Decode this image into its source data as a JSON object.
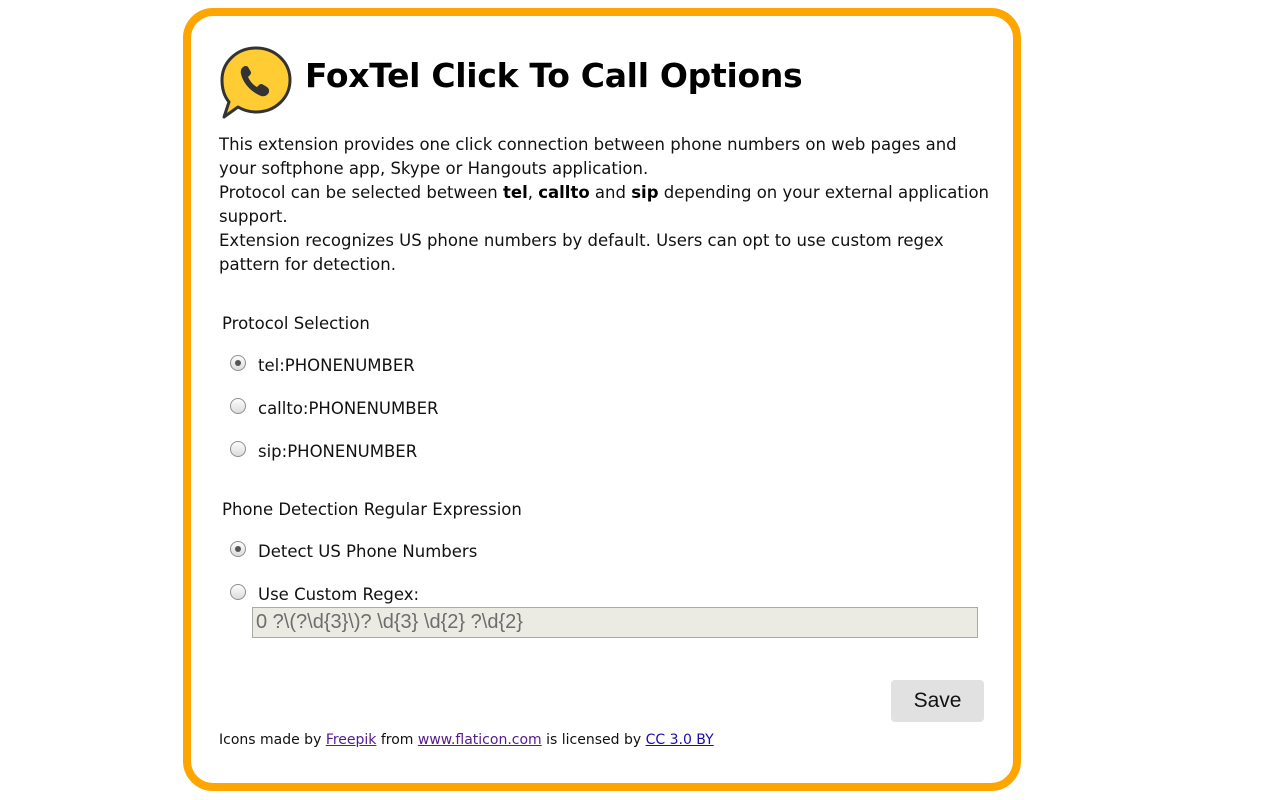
{
  "header": {
    "title": "FoxTel Click To Call Options",
    "logo_icon": "phone-speech-bubble-icon"
  },
  "description": {
    "line1": "This extension provides one click connection between phone numbers on web pages and your softphone app, Skype or Hangouts application.",
    "line2_prefix": "Protocol can be selected between ",
    "line2_tel": "tel",
    "line2_sep1": ", ",
    "line2_callto": "callto",
    "line2_sep2": " and ",
    "line2_sip": "sip",
    "line2_suffix": " depending on your external application support.",
    "line3": "Extension recognizes US phone numbers by default. Users can opt to use custom regex pattern for detection."
  },
  "protocol": {
    "heading": "Protocol Selection",
    "options": [
      {
        "label": "tel:PHONENUMBER",
        "checked": true
      },
      {
        "label": "callto:PHONENUMBER",
        "checked": false
      },
      {
        "label": "sip:PHONENUMBER",
        "checked": false
      }
    ]
  },
  "detection": {
    "heading": "Phone Detection Regular Expression",
    "options": [
      {
        "label": "Detect US Phone Numbers",
        "checked": true
      },
      {
        "label": "Use Custom Regex:",
        "checked": false
      }
    ],
    "regex_value": "0 ?\\(?\\d{3}\\)? \\d{3} \\d{2} ?\\d{2}",
    "regex_disabled": true
  },
  "actions": {
    "save_label": "Save"
  },
  "credits": {
    "prefix": "Icons made by ",
    "author": "Freepik",
    "from": " from ",
    "site": "www.flaticon.com",
    "licensed": " is licensed by ",
    "license": "CC 3.0 BY"
  },
  "colors": {
    "border_accent": "#ffa500",
    "logo_yellow": "#ffcc33"
  }
}
